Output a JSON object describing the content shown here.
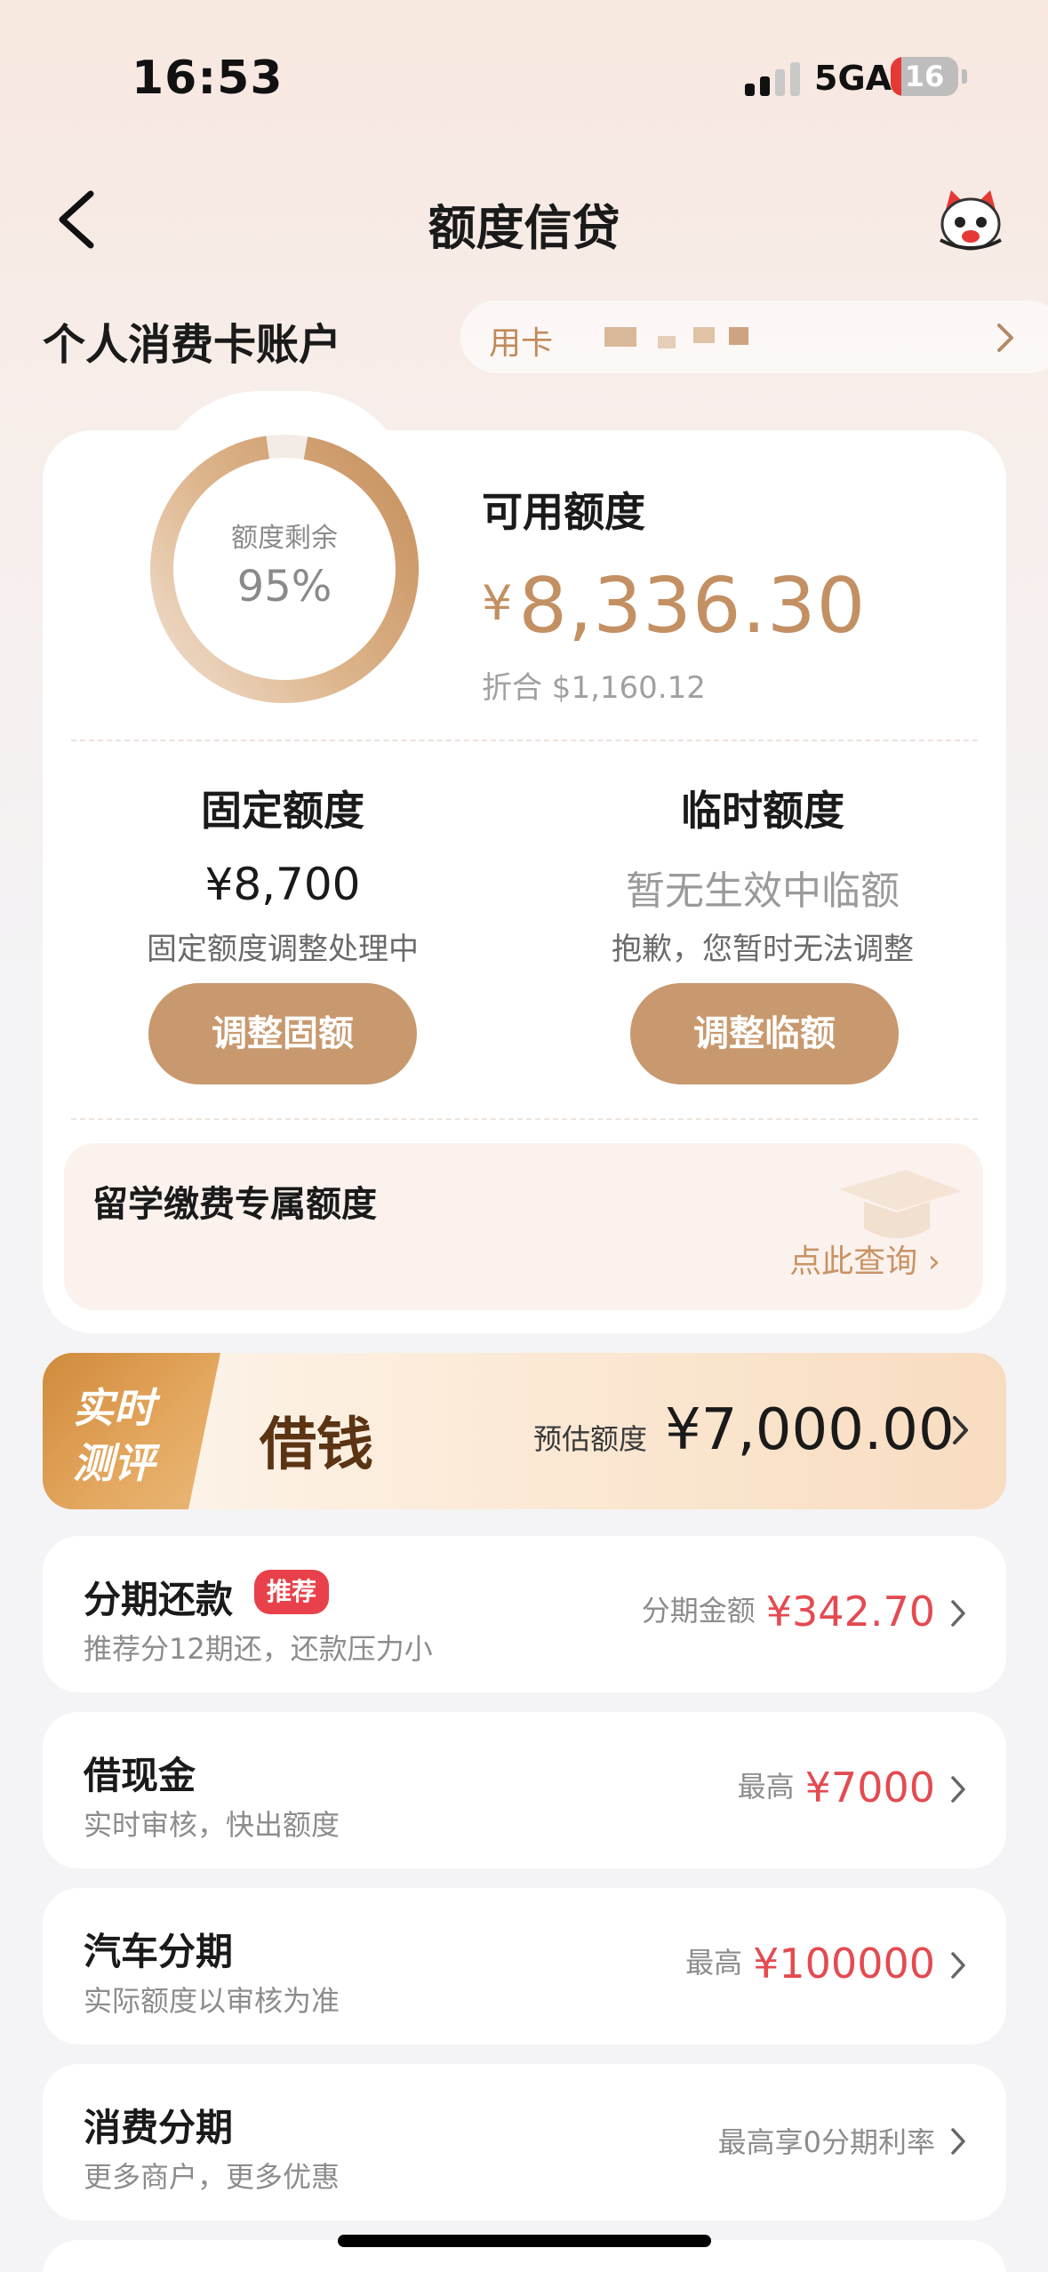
{
  "status_bar": {
    "time": "16:53",
    "network": "5GA",
    "battery": "16",
    "battery_level": 0.16
  },
  "nav": {
    "title": "额度信贷",
    "back_icon": "chevron-left-icon",
    "mascot_icon": "mascot-icon"
  },
  "account": {
    "title": "个人消费卡账户",
    "card_label": "用卡"
  },
  "quota": {
    "ring_label": "额度剩余",
    "ring_value": "95%",
    "ring_fraction": 0.95,
    "available_label": "可用额度",
    "currency_symbol": "¥",
    "available_amount": "8,336.30",
    "converted": "折合 $1,160.12",
    "fixed": {
      "title": "固定额度",
      "amount": "¥8,700",
      "desc": "固定额度调整处理中",
      "button": "调整固额"
    },
    "temporary": {
      "title": "临时额度",
      "amount": "暂无生效中临额",
      "desc": "抱歉，您暂时无法调整",
      "button": "调整临额"
    },
    "study": {
      "title": "留学缴费专属额度",
      "link": "点此查询 ›"
    }
  },
  "loan_banner": {
    "tag_line1": "实时",
    "tag_line2": "测评",
    "title": "借钱",
    "estimate_label": "预估额度",
    "estimate_amount": "¥7,000.00"
  },
  "products": [
    {
      "name": "分期还款",
      "badge": "推荐",
      "sub": "推荐分12期还，还款压力小",
      "right_label": "分期金额",
      "right_value": "¥342.70"
    },
    {
      "name": "借现金",
      "sub": "实时审核，快出额度",
      "right_label": "最高",
      "right_value": "¥7000"
    },
    {
      "name": "汽车分期",
      "sub": "实际额度以审核为准",
      "right_label": "最高",
      "right_value": "¥100000"
    },
    {
      "name": "消费分期",
      "sub": "更多商户，更多优惠",
      "right_label": "最高享0分期利率"
    }
  ],
  "colors": {
    "accent": "#c8996e",
    "price_red": "#e34b51",
    "badge_red": "#e8414b",
    "loan_brown": "#5b3414"
  }
}
